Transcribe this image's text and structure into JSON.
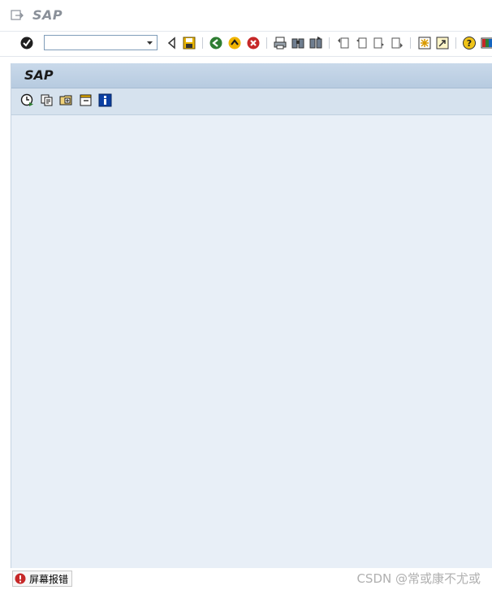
{
  "window": {
    "title": "SAP"
  },
  "toolbar": {
    "command_field_value": "",
    "icons": [
      "enter-icon",
      "back-arrow-icon",
      "save-icon",
      "back-icon",
      "exit-icon",
      "cancel-icon",
      "print-icon",
      "find-icon",
      "find-next-icon",
      "first-page-icon",
      "previous-page-icon",
      "next-page-icon",
      "last-page-icon",
      "create-session-icon",
      "shortcut-icon",
      "help-icon",
      "layout-menu-icon"
    ]
  },
  "panel": {
    "title": "SAP",
    "app_icons": [
      "execute-icon",
      "copy-icon",
      "expand-icon",
      "collapse-icon",
      "info-icon"
    ]
  },
  "statusbar": {
    "label": "屏幕报错"
  },
  "watermark": "CSDN @常或康不尤或",
  "colors": {
    "panel_bg": "#e8eff7",
    "header_bg": "#c9d9ea",
    "accent_green": "#2e7d32",
    "error_red": "#d32f2f"
  }
}
